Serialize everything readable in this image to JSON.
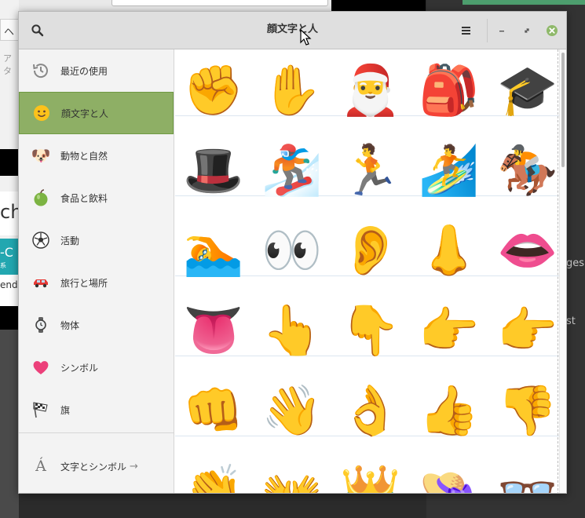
{
  "background": {
    "left_fragments": [
      "ヘル",
      "ア タ",
      "ch",
      "-C",
      "系",
      "ende"
    ],
    "right_fragments": [
      "ges",
      "st"
    ]
  },
  "window": {
    "title": "顔文字と人",
    "buttons": [
      "search-icon",
      "menu-icon",
      "minimize-icon",
      "maximize-icon",
      "close-icon"
    ]
  },
  "sidebar": {
    "items": [
      {
        "label": "最近の使用",
        "icon": "clock-icon",
        "active": false
      },
      {
        "label": "顔文字と人",
        "icon": "smiley-icon",
        "active": true
      },
      {
        "label": "動物と自然",
        "icon": "dog-icon",
        "active": false
      },
      {
        "label": "食品と飲料",
        "icon": "apple-icon",
        "active": false
      },
      {
        "label": "活動",
        "icon": "soccer-ball-icon",
        "active": false
      },
      {
        "label": "旅行と場所",
        "icon": "car-icon",
        "active": false
      },
      {
        "label": "物体",
        "icon": "watch-icon",
        "active": false
      },
      {
        "label": "シンボル",
        "icon": "heart-icon",
        "active": false
      },
      {
        "label": "旗",
        "icon": "checkered-flag-icon",
        "active": false
      }
    ],
    "text_symbols": {
      "label": "文字とシンボル",
      "icon_char": "Á",
      "arrow": "→"
    }
  },
  "emoji_rows": [
    [
      "✊",
      "✋",
      "🎅",
      "🎒",
      "🎓"
    ],
    [
      "🎩",
      "🏂",
      "🏃",
      "🏄",
      "🏇"
    ],
    [
      "🏊",
      "👀",
      "👂",
      "👃",
      "👄"
    ],
    [
      "👅",
      "👆",
      "👇",
      "👉",
      "👉"
    ],
    [
      "👊",
      "👋",
      "👌",
      "👍",
      "👎"
    ],
    [
      "👏",
      "👐",
      "👑",
      "👒",
      "👓"
    ]
  ],
  "emoji_names": [
    [
      "raised-fist",
      "raised-hand",
      "santa-claus",
      "school-backpack",
      "graduation-cap"
    ],
    [
      "top-hat",
      "snowboarder",
      "runner",
      "surfer",
      "horse-racing"
    ],
    [
      "swimmer",
      "eyes",
      "ear",
      "nose",
      "mouth"
    ],
    [
      "tongue",
      "pointing-up",
      "pointing-down",
      "pointing-right",
      "pointing-right"
    ],
    [
      "fisted-hand",
      "waving-hand",
      "ok-hand",
      "thumbs-up",
      "thumbs-down"
    ],
    [
      "clapping-hands",
      "open-hands",
      "crown",
      "womans-hat",
      "eyeglasses"
    ]
  ]
}
